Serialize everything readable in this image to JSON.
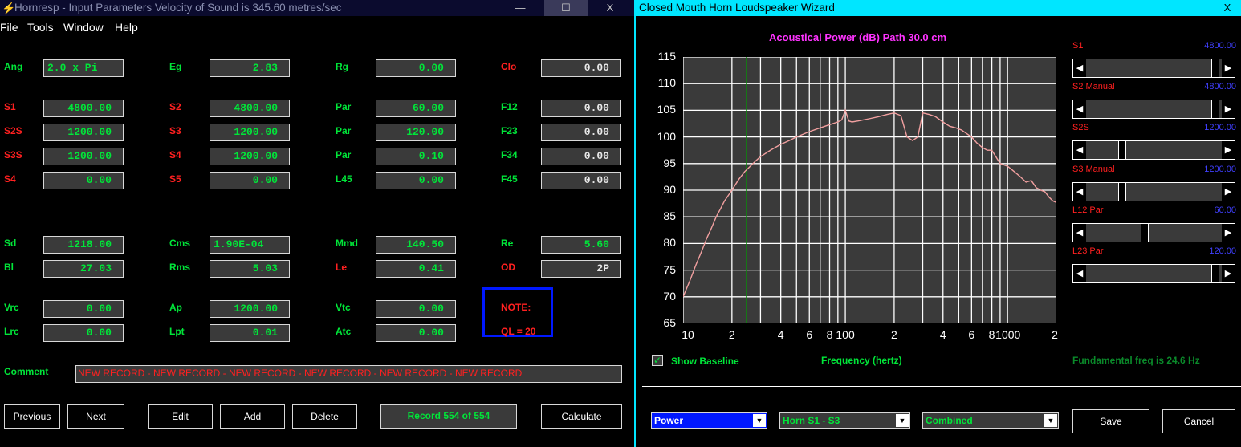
{
  "w1": {
    "title": "Hornresp - Input Parameters   Velocity of Sound is 345.60 metres/sec",
    "controls": {
      "min": "—",
      "max": "☐",
      "close": "X"
    },
    "menu": [
      "File",
      "Tools",
      "Window",
      "Help"
    ],
    "rows": [
      {
        "l1": "Ang",
        "v1": "2.0 x Pi",
        "l2": "Eg",
        "v2": "2.83",
        "l3": "Rg",
        "v3": "0.00",
        "l4": "Clo",
        "v4": "0.00"
      },
      {
        "l1": "S1",
        "v1": "4800.00",
        "l2": "S2",
        "v2": "4800.00",
        "l3": "Par",
        "v3": "60.00",
        "l4": "F12",
        "v4": "0.00"
      },
      {
        "l1": "S2S",
        "v1": "1200.00",
        "l2": "S3",
        "v2": "1200.00",
        "l3": "Par",
        "v3": "120.00",
        "l4": "F23",
        "v4": "0.00"
      },
      {
        "l1": "S3S",
        "v1": "1200.00",
        "l2": "S4",
        "v2": "1200.00",
        "l3": "Par",
        "v3": "0.10",
        "l4": "F34",
        "v4": "0.00"
      },
      {
        "l1": "S4",
        "v1": "0.00",
        "l2": "S5",
        "v2": "0.00",
        "l3": "L45",
        "v3": "0.00",
        "l4": "F45",
        "v4": "0.00"
      },
      {
        "l1": "Sd",
        "v1": "1218.00",
        "l2": "Cms",
        "v2": "1.90E-04",
        "l3": "Mmd",
        "v3": "140.50",
        "l4": "Re",
        "v4": "5.60"
      },
      {
        "l1": "Bl",
        "v1": "27.03",
        "l2": "Rms",
        "v2": "5.03",
        "l3": "Le",
        "v3": "0.41",
        "l4": "OD",
        "v4": "2P"
      },
      {
        "l1": "Vrc",
        "v1": "0.00",
        "l2": "Ap",
        "v2": "1200.00",
        "l3": "Vtc",
        "v3": "0.00"
      },
      {
        "l1": "Lrc",
        "v1": "0.00",
        "l2": "Lpt",
        "v2": "0.01",
        "l3": "Atc",
        "v3": "0.00"
      }
    ],
    "note": {
      "line1": "NOTE:",
      "line2": "QL = 20"
    },
    "comment_label": "Comment",
    "comment": "NEW RECORD - NEW RECORD - NEW RECORD - NEW RECORD - NEW RECORD - NEW RECORD",
    "buttons": {
      "previous": "Previous",
      "next": "Next",
      "edit": "Edit",
      "add": "Add",
      "delete": "Delete",
      "calculate": "Calculate"
    },
    "record": "Record 554 of 554"
  },
  "w2": {
    "title": "Closed Mouth Horn Loudspeaker Wizard",
    "close": "X",
    "chart_title": "Acoustical Power (dB)   Path 30.0 cm",
    "xaxis_label": "Frequency (hertz)",
    "show_baseline": "Show Baseline",
    "fundamental": "Fundamental freq is 24.6 Hz",
    "sliders": [
      {
        "label": "S1",
        "value": "4800.00",
        "pos": 0.98
      },
      {
        "label": "S2 Manual",
        "value": "4800.00",
        "pos": 0.98
      },
      {
        "label": "S2S",
        "value": "1200.00",
        "pos": 0.25
      },
      {
        "label": "S3 Manual",
        "value": "1200.00",
        "pos": 0.25
      },
      {
        "label": "L12 Par",
        "value": "60.00",
        "pos": 0.43
      },
      {
        "label": "L23 Par",
        "value": "120.00",
        "pos": 0.98
      }
    ],
    "combos": [
      "Power",
      "Horn S1 - S3",
      "Combined"
    ],
    "save": "Save",
    "cancel": "Cancel"
  },
  "chart_data": {
    "type": "line",
    "title": "Acoustical Power (dB)   Path 30.0 cm",
    "xlabel": "Frequency (hertz)",
    "xscale": "log",
    "xlim": [
      10,
      2000
    ],
    "ylim": [
      65,
      115
    ],
    "yticks": [
      115,
      110,
      105,
      100,
      95,
      90,
      85,
      80,
      75,
      70,
      65
    ],
    "xtick_labels": [
      "10",
      "2",
      "4",
      "6",
      "8",
      "100",
      "2",
      "4",
      "6",
      "8",
      "1000",
      "2"
    ],
    "marker_x": 24.6,
    "series": [
      {
        "x": [
          10,
          11,
          12,
          13,
          14,
          15,
          16,
          17,
          18,
          20,
          22,
          24,
          25,
          28,
          30,
          35,
          40,
          45,
          50,
          60,
          70,
          80,
          90,
          95,
          100,
          105,
          110,
          120,
          140,
          160,
          180,
          200,
          220,
          240,
          260,
          280,
          300,
          330,
          360,
          400,
          440,
          480,
          520,
          600,
          650,
          700,
          750,
          800,
          900,
          1000,
          1100,
          1200,
          1300,
          1400,
          1500,
          1600,
          1700,
          1800,
          1900,
          2000
        ],
        "y": [
          70,
          73,
          76,
          78.5,
          81,
          83,
          85,
          86.5,
          88,
          90,
          92,
          93.5,
          94,
          95.5,
          96.3,
          97.6,
          98.6,
          99.3,
          100,
          101,
          101.7,
          102.3,
          102.8,
          103.2,
          105,
          103,
          102.8,
          103,
          103.4,
          103.8,
          104.2,
          104.5,
          104,
          100,
          99.3,
          100,
          104.5,
          104.2,
          103.8,
          102.8,
          102,
          101.7,
          101.3,
          100,
          98.8,
          98,
          97.5,
          97.5,
          95,
          94.5,
          93.5,
          92.5,
          91.5,
          91.8,
          90.5,
          90,
          89.7,
          88.7,
          88,
          87.7
        ]
      }
    ]
  }
}
